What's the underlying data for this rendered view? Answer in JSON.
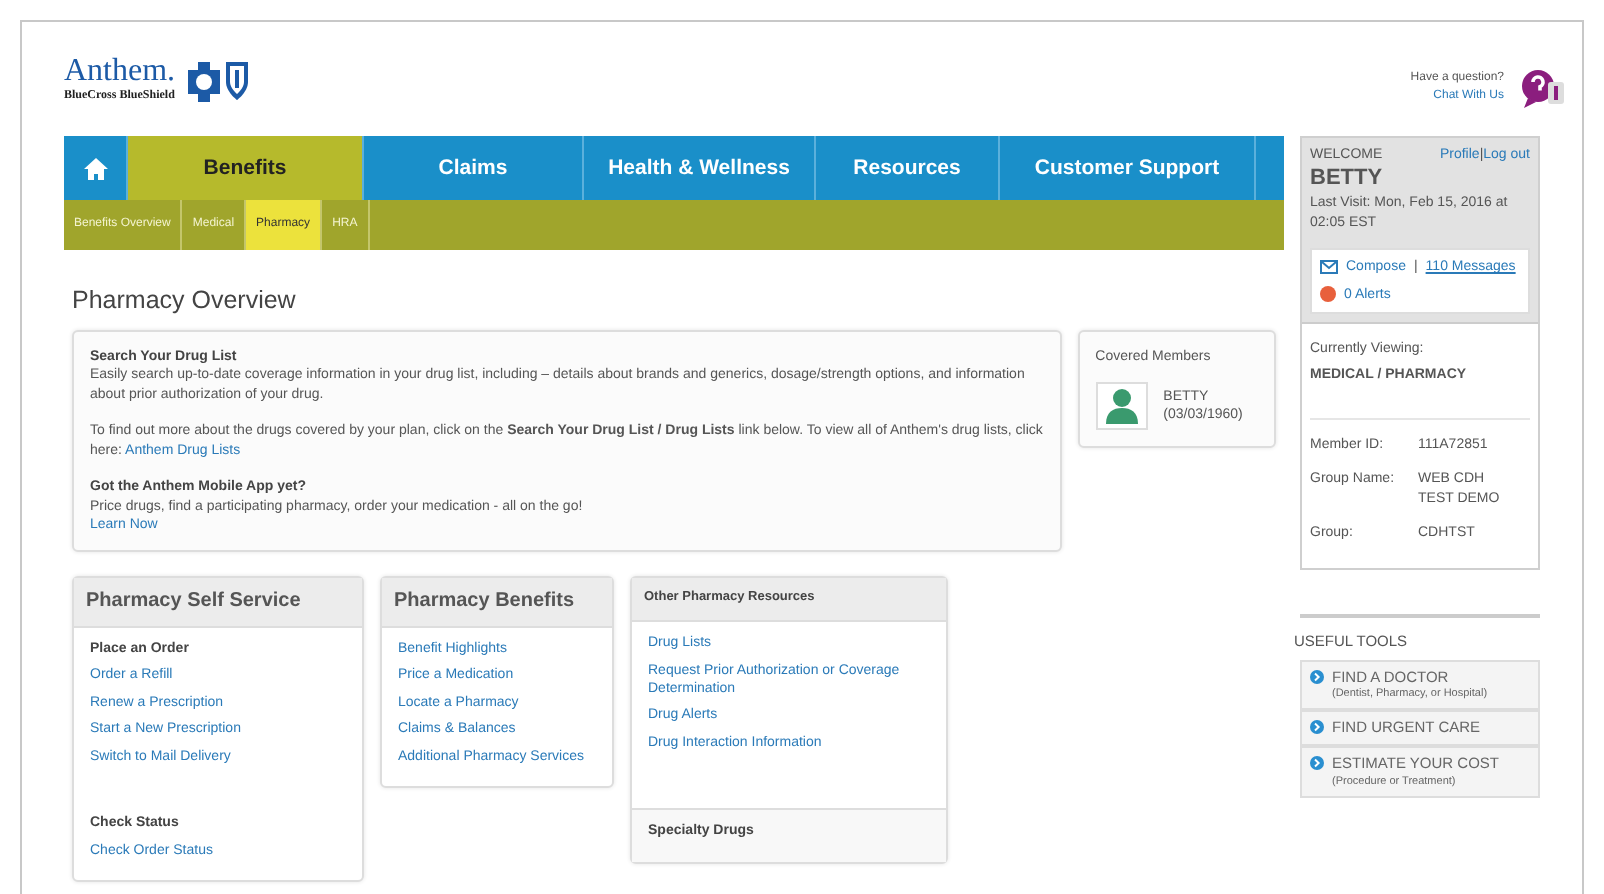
{
  "logo": {
    "brand": "Anthem.",
    "tagline": "BlueCross BlueShield"
  },
  "help": {
    "question": "Have a question?",
    "link": "Chat With Us"
  },
  "nav": [
    {
      "kind": "home",
      "selected": false
    },
    {
      "kind": "text",
      "label": "Benefits",
      "selected": true
    },
    {
      "kind": "text",
      "label": "Claims",
      "selected": false
    },
    {
      "kind": "text",
      "label": "Health & Wellness",
      "selected": false
    },
    {
      "kind": "text",
      "label": "Resources",
      "selected": false
    },
    {
      "kind": "text",
      "label": "Customer Support",
      "selected": false
    }
  ],
  "subnav": [
    {
      "label": "Benefits Overview",
      "selected": false
    },
    {
      "label": "Medical",
      "selected": false
    },
    {
      "label": "Pharmacy",
      "selected": true
    },
    {
      "label": "HRA",
      "selected": false
    }
  ],
  "page_title": "Pharmacy Overview",
  "overview": [
    {
      "heading": "Search Your Drug List",
      "text": "Easily search up-to-date coverage information in your drug list, including – details about brands and generics, dosage/strength options, and information about prior authorization of your drug."
    },
    {
      "text": "To find out more about the drugs covered by your plan, click on the **Search Your Drug List / Drug Lists** link below. To view all of Anthem's drug lists, click here:",
      "link": "Anthem Drug Lists"
    },
    {
      "heading": "Got the Anthem Mobile App yet?",
      "text": "Price drugs, find a participating pharmacy, order your medication - all on the go!",
      "link": "Learn Now"
    }
  ],
  "covered_members": {
    "title": "Covered Members",
    "members": [
      {
        "name": "BETTY",
        "birth_date": "(03/03/1960)"
      }
    ]
  },
  "cards": [
    {
      "title": "Pharmacy Self Service",
      "kind": "large",
      "groups": [
        {
          "heading": "Place an Order",
          "links": [
            "Order a Refill",
            "Renew a Prescription",
            "Start a New Prescription",
            "Switch to Mail Delivery"
          ]
        },
        {
          "heading": "Check Status",
          "links": [
            "Check Order Status"
          ]
        }
      ]
    },
    {
      "title": "Pharmacy Benefits",
      "kind": "large",
      "groups": [
        {
          "links": [
            "Benefit Highlights",
            "Price a Medication",
            "Locate a Pharmacy",
            "Claims & Balances",
            "Additional Pharmacy Services"
          ]
        }
      ]
    },
    {
      "title": "Other Pharmacy Resources",
      "kind": "small",
      "groups": [
        {
          "links": [
            "Drug Lists",
            "Request Prior Authorization or Coverage Determination",
            "Drug Alerts",
            "Drug Interaction Information"
          ]
        },
        {
          "heading": "Specialty Drugs"
        }
      ]
    }
  ],
  "account": {
    "welcome": "WELCOME",
    "name": "BETTY",
    "profile_link": "Profile",
    "separator": "|",
    "logout_link": "Log out",
    "last_visit": "Last Visit: Mon, Feb 15, 2016 at 02:05 EST",
    "compose": "Compose",
    "messages": "110 Messages",
    "alerts": "0 Alerts",
    "viewing_label": "Currently Viewing:",
    "viewing_value": "MEDICAL / PHARMACY",
    "fields": [
      {
        "label": "Member ID:",
        "value": "111A72851"
      },
      {
        "label": "Group Name:",
        "value": "WEB CDH TEST DEMO"
      },
      {
        "label": "Group:",
        "value": "CDHTST"
      }
    ]
  },
  "useful_tools": {
    "title": "USEFUL TOOLS",
    "items": [
      {
        "title": "FIND A DOCTOR",
        "subtitle": "(Dentist, Pharmacy, or Hospital)"
      },
      {
        "title": "FIND URGENT CARE"
      },
      {
        "title": "ESTIMATE YOUR COST",
        "subtitle": "(Procedure or Treatment)"
      }
    ]
  }
}
